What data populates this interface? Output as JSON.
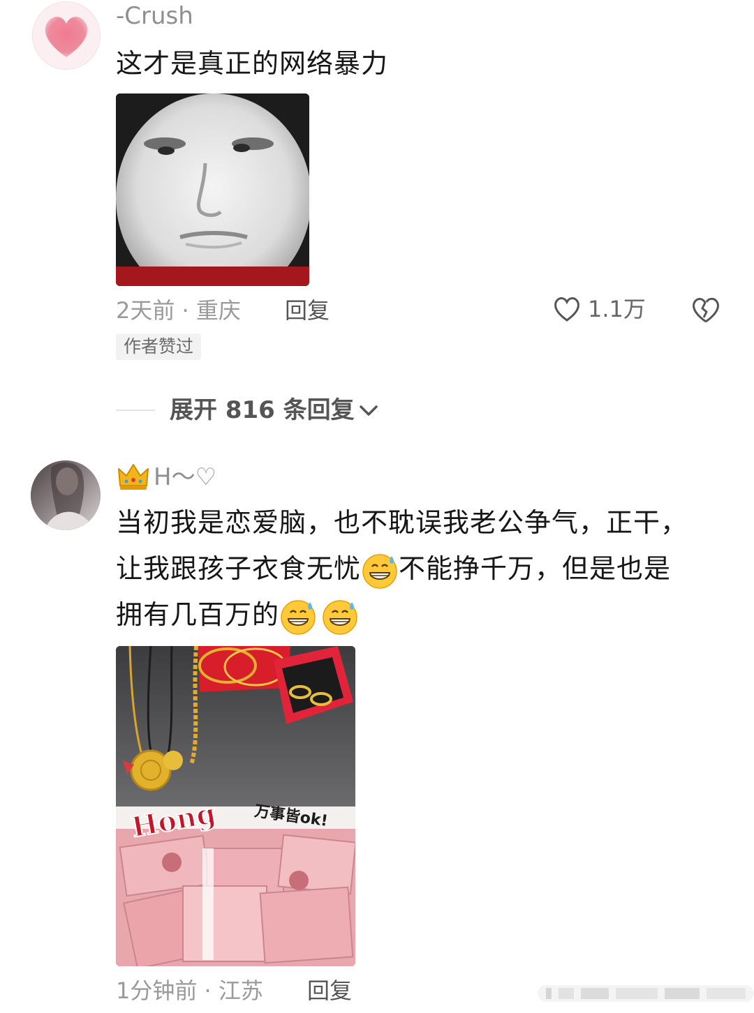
{
  "comment1": {
    "username": "-Crush",
    "text": "这才是真正的网络暴力",
    "meta": "2天前 · 重庆",
    "reply": "回复",
    "likes": "1.1万",
    "badge": "作者赞过",
    "expand": "展开 816 条回复",
    "avatar_icon": "heart-avatar",
    "image_desc": "meme-face-image"
  },
  "comment2": {
    "username": "H～♡",
    "text_parts": [
      "当初我是恋爱脑，也不耽误我老公争气，正干，",
      "让我跟孩子衣食无忧",
      "不能挣千万，但是也是",
      "拥有几百万的"
    ],
    "emoji": "grinning-sweat-emoji",
    "image_texts": {
      "hong": "Hong",
      "slogan": "万事皆ok!"
    },
    "meta": "1分钟前 · 江苏",
    "reply": "回复",
    "crown_icon": "crown-icon"
  },
  "colors": {
    "text": "#161616",
    "meta": "#9a9a9a",
    "reply": "#555555",
    "badge_bg": "#f2f2f2"
  }
}
